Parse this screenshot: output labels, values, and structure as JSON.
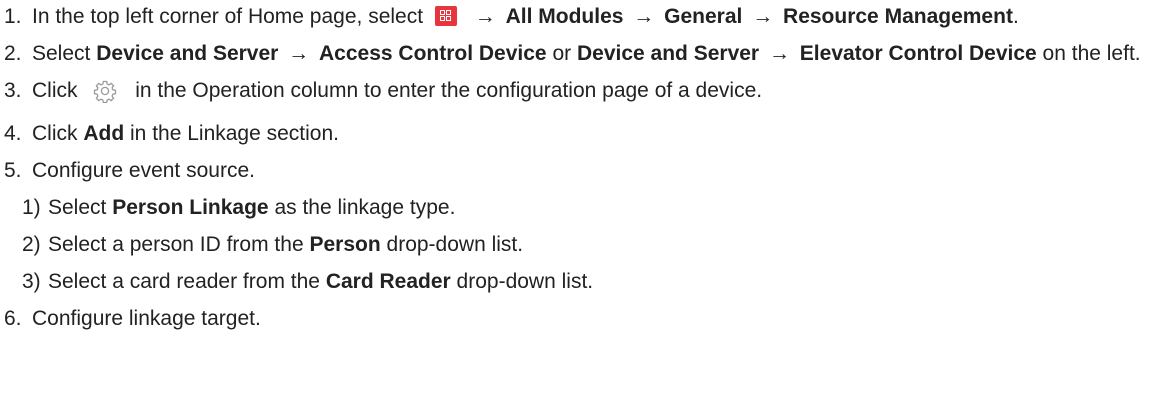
{
  "steps": {
    "s1": {
      "num": "1.",
      "pre": "In the top left corner of Home page, select",
      "icon": "grid-menu-icon",
      "arrow": "→",
      "path1": "All Modules",
      "path2": "General",
      "path3": "Resource Management",
      "end": "."
    },
    "s2": {
      "num": "2.",
      "pre": "Select",
      "a1": "Device and Server",
      "arrow": "→",
      "a2": "Access Control Device",
      "or": "or",
      "b1": "Device and Server",
      "b2": "Elevator Control Device",
      "end": "on the left."
    },
    "s3": {
      "num": "3.",
      "pre": "Click",
      "icon": "gear-icon",
      "post": "in the Operation column to enter the configuration page of a device."
    },
    "s4": {
      "num": "4.",
      "pre": "Click",
      "bold": "Add",
      "post": "in the Linkage section."
    },
    "s5": {
      "num": "5.",
      "text": "Configure event source.",
      "subs": [
        {
          "num": "1)",
          "pre": "Select",
          "bold": "Person Linkage",
          "post": "as the linkage type."
        },
        {
          "num": "2)",
          "pre": "Select a person ID from the",
          "bold": "Person",
          "post": "drop-down list."
        },
        {
          "num": "3)",
          "pre": "Select a card reader from the",
          "bold": "Card Reader",
          "post": "drop-down list."
        }
      ]
    },
    "s6": {
      "num": "6.",
      "text": "Configure linkage target."
    }
  },
  "colors": {
    "text": "#222222",
    "menu_icon": "#e8343c",
    "gear_icon": "#9a9a9a"
  }
}
